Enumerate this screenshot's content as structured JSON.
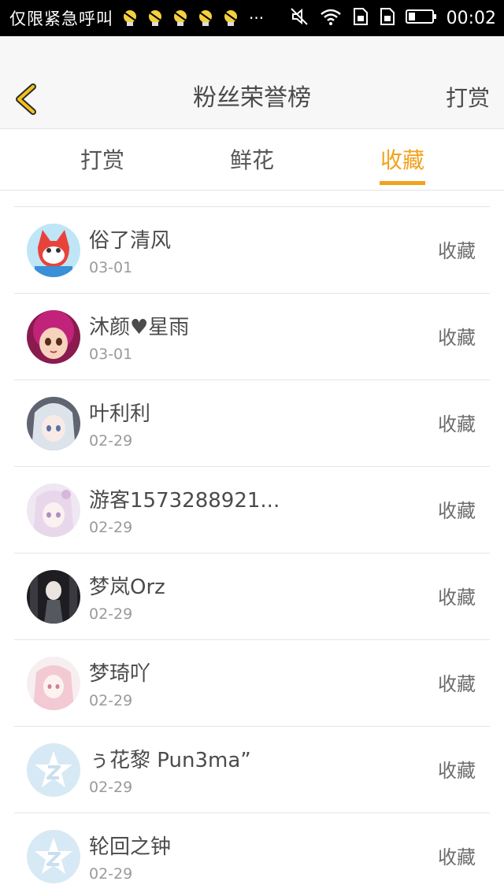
{
  "status_bar": {
    "left_text": "仅限紧急呼叫",
    "overflow": "···",
    "time": "00:02",
    "icons": [
      "bulb-icon",
      "bulb-icon",
      "bulb-icon",
      "bulb-icon",
      "bulb-icon",
      "mute-icon",
      "wifi-icon",
      "sim1-icon",
      "sim2-icon",
      "battery-icon"
    ]
  },
  "header": {
    "back_icon": "chevron-left-icon",
    "title": "粉丝荣誉榜",
    "action": "打赏"
  },
  "tabs": [
    {
      "label": "打赏",
      "active": false
    },
    {
      "label": "鲜花",
      "active": false
    },
    {
      "label": "收藏",
      "active": true
    }
  ],
  "colors": {
    "accent": "#f2a21b",
    "text": "#4b4b4b",
    "subtext": "#9a9a9a",
    "divider": "#e4e4e4"
  },
  "fans": [
    {
      "name": "俗了清风",
      "date": "03-01",
      "action": "收藏",
      "avatar": "fox-cartoon-avatar"
    },
    {
      "name": "沐颜♥星雨",
      "date": "03-01",
      "action": "收藏",
      "avatar": "pink-hair-girl-avatar"
    },
    {
      "name": "叶利利",
      "date": "02-29",
      "action": "收藏",
      "avatar": "anime-girl-avatar"
    },
    {
      "name": "游客1573288921...",
      "date": "02-29",
      "action": "收藏",
      "avatar": "pastel-anime-avatar"
    },
    {
      "name": "梦岚Orz",
      "date": "02-29",
      "action": "收藏",
      "avatar": "dark-anime-avatar"
    },
    {
      "name": "梦琦吖",
      "date": "02-29",
      "action": "收藏",
      "avatar": "pink-anime-avatar"
    },
    {
      "name": "ぅ花黎 Pun3ma”",
      "date": "02-29",
      "action": "收藏",
      "avatar": "default-star-avatar"
    },
    {
      "name": "轮回之钟",
      "date": "02-29",
      "action": "收藏",
      "avatar": "default-star-avatar"
    }
  ]
}
